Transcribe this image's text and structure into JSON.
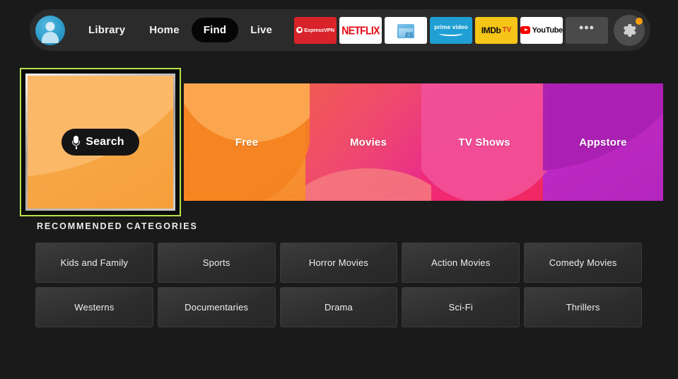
{
  "nav": {
    "avatar_name": "user-avatar",
    "links": [
      {
        "label": "Library",
        "selected": false
      },
      {
        "label": "Home",
        "selected": false
      },
      {
        "label": "Find",
        "selected": true
      },
      {
        "label": "Live",
        "selected": false
      }
    ],
    "apps": [
      {
        "name": "expressvpn",
        "label": "ExpressVPN"
      },
      {
        "name": "netflix",
        "label": "NETFLIX"
      },
      {
        "name": "es-file-explorer",
        "label": "ES"
      },
      {
        "name": "prime-video",
        "label": "prime video"
      },
      {
        "name": "imdb-tv",
        "label": "IMDb",
        "label2": "TV"
      },
      {
        "name": "youtube",
        "label": "YouTube"
      },
      {
        "name": "more",
        "label": "•••"
      }
    ],
    "settings": {
      "label": "Settings",
      "has_notification": true
    }
  },
  "hero": {
    "search": {
      "label": "Search",
      "focused": true,
      "focus_color": "#b9e14a"
    },
    "tiles": [
      {
        "label": "Free",
        "color": "#f7972f"
      },
      {
        "label": "Movies",
        "color": "#ee3c7c"
      },
      {
        "label": "TV Shows",
        "color": "#ef2a7e"
      },
      {
        "label": "Appstore",
        "color": "#bd28c2"
      }
    ]
  },
  "recommended": {
    "title": "RECOMMENDED CATEGORIES",
    "rows": [
      [
        {
          "label": "Kids and Family"
        },
        {
          "label": "Sports"
        },
        {
          "label": "Horror Movies"
        },
        {
          "label": "Action Movies"
        },
        {
          "label": "Comedy Movies"
        }
      ],
      [
        {
          "label": "Westerns"
        },
        {
          "label": "Documentaries"
        },
        {
          "label": "Drama"
        },
        {
          "label": "Sci-Fi"
        },
        {
          "label": "Thrillers"
        }
      ]
    ]
  },
  "theme": {
    "background": "#1a1a1a",
    "nav_background": "#2b2b2b",
    "accent_focus": "#b9e14a",
    "notification": "#f59e0b"
  }
}
